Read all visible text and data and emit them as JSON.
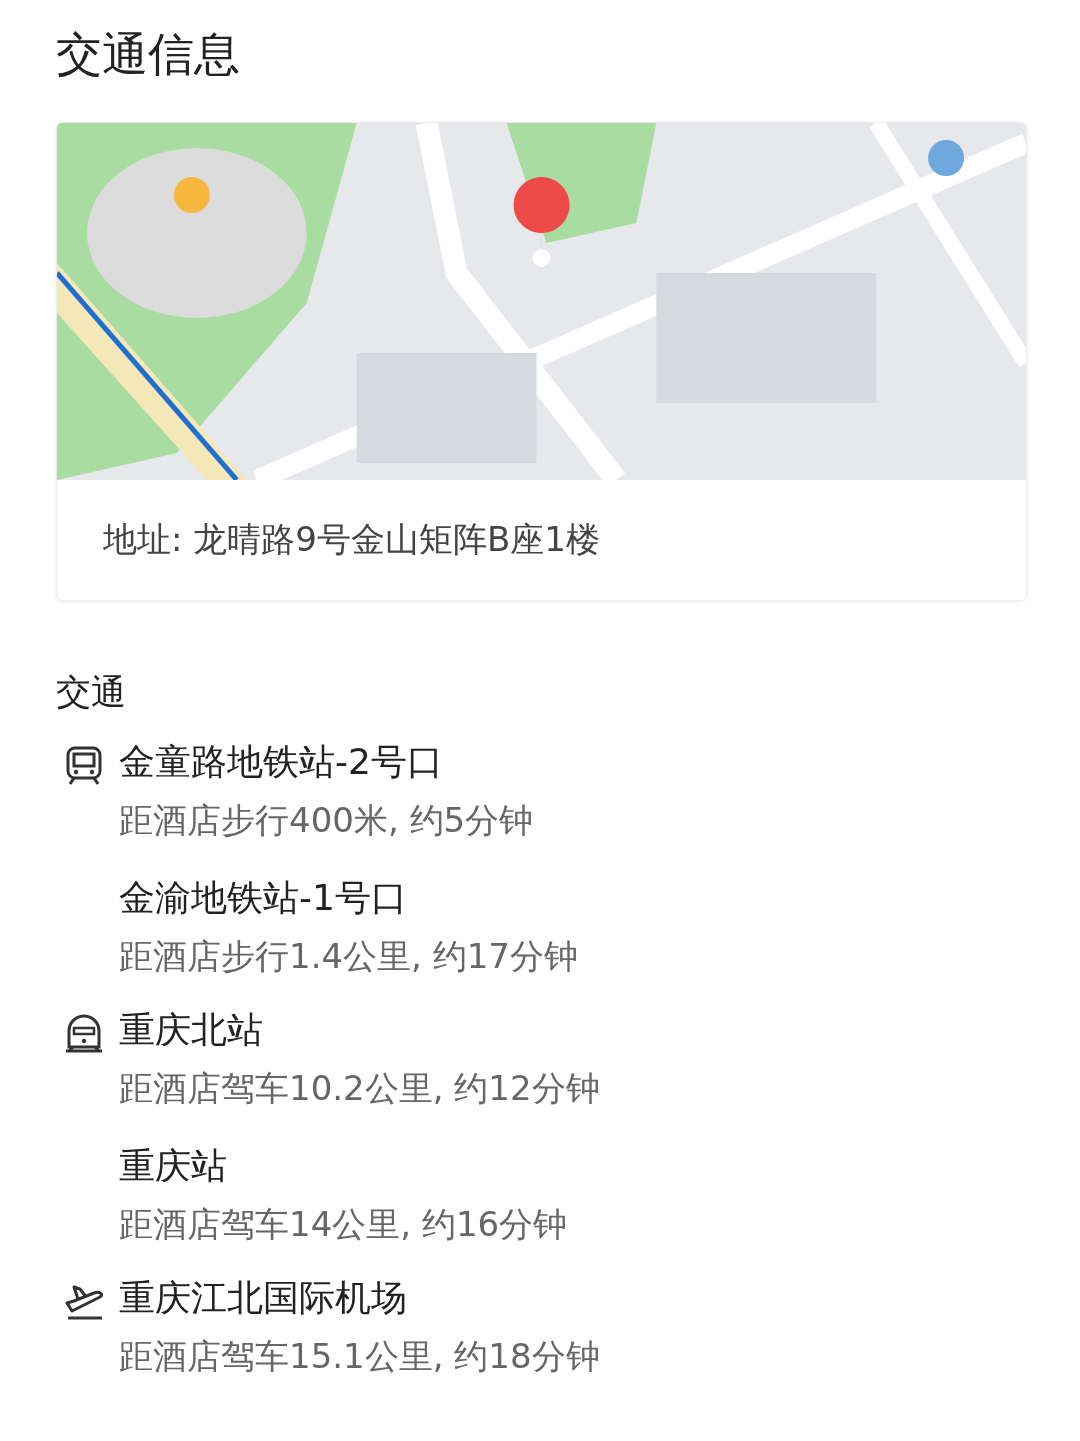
{
  "title": "交通信息",
  "map": {
    "kind": "picture",
    "address": "地址: 龙晴路9号金山矩阵B座1楼"
  },
  "section_title": "交通",
  "groups": [
    {
      "kind": "metro",
      "stops": [
        {
          "name": "金童路地铁站-2号口",
          "detail": "距酒店步行400米, 约5分钟"
        },
        {
          "name": "金渝地铁站-1号口",
          "detail": "距酒店步行1.4公里, 约17分钟"
        }
      ]
    },
    {
      "kind": "train",
      "stops": [
        {
          "name": "重庆北站",
          "detail": "距酒店驾车10.2公里, 约12分钟"
        },
        {
          "name": "重庆站",
          "detail": "距酒店驾车14公里, 约16分钟"
        }
      ]
    },
    {
      "kind": "plane",
      "stops": [
        {
          "name": "重庆江北国际机场",
          "detail": "距酒店驾车15.1公里, 约18分钟"
        }
      ]
    }
  ]
}
